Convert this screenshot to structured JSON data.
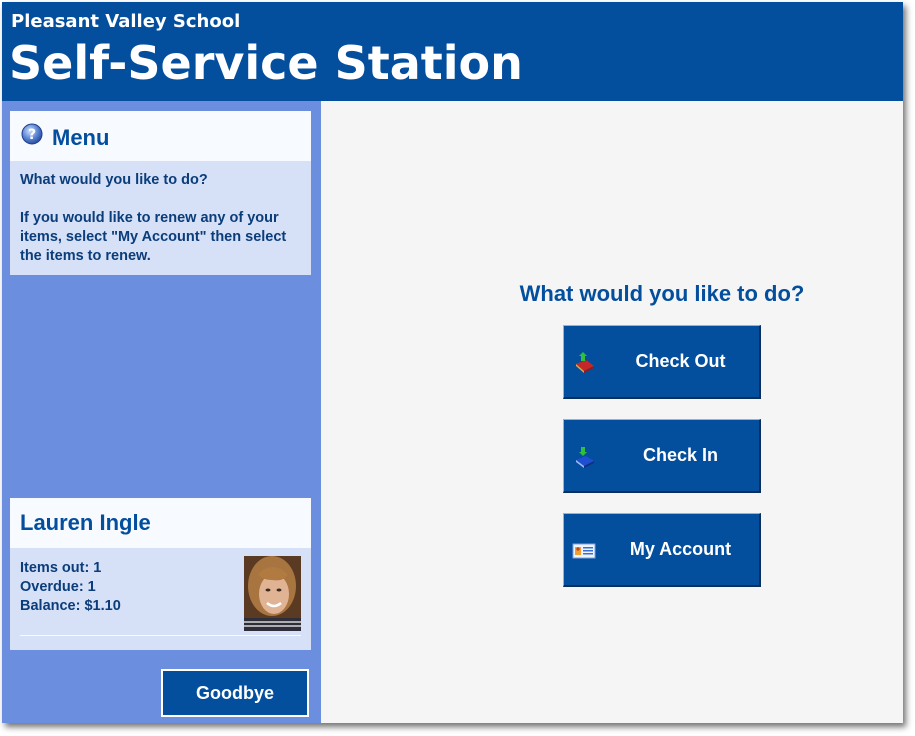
{
  "header": {
    "school_name": "Pleasant Valley School",
    "app_title": "Self-Service Station"
  },
  "menu": {
    "title": "Menu",
    "icon": "help-icon",
    "line1": "What would you like to do?",
    "line2": "If you would like to renew any of your items, select \"My Account\" then select the items to renew."
  },
  "patron": {
    "name": "Lauren Ingle",
    "items_out": "Items out: 1",
    "overdue": "Overdue: 1",
    "balance": "Balance: $1.10"
  },
  "goodbye_label": "Goodbye",
  "main": {
    "question": "What would you like to do?",
    "actions": [
      {
        "label": "Check Out",
        "icon": "check-out-icon"
      },
      {
        "label": "Check In",
        "icon": "check-in-icon"
      },
      {
        "label": "My Account",
        "icon": "account-card-icon"
      }
    ]
  },
  "colors": {
    "brand_blue": "#034e9d",
    "sidebar_blue": "#6b8ede",
    "panel_bg": "#d6e0f7",
    "main_bg": "#f5f5f5"
  }
}
